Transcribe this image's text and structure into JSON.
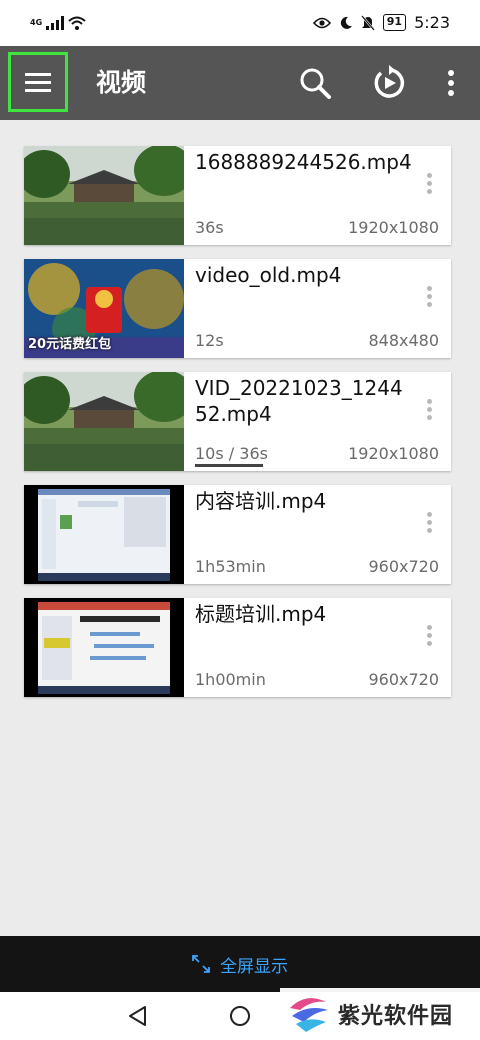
{
  "status_bar": {
    "network": "4G",
    "battery": "91",
    "time": "5:23"
  },
  "app_bar": {
    "title": "视频"
  },
  "videos": [
    {
      "name": "1688889244526.mp4",
      "duration": "36s",
      "resolution": "1920x1080",
      "thumbnail": "garden-pavilion"
    },
    {
      "name": "video_old.mp4",
      "duration": "12s",
      "resolution": "848x480",
      "thumbnail": "game-red-envelope",
      "thumb_text": "20元话费红包"
    },
    {
      "name": "VID_20221023_124452.mp4",
      "duration": "10s / 36s",
      "resolution": "1920x1080",
      "thumbnail": "garden-pavilion",
      "progress": 0.28
    },
    {
      "name": "内容培训.mp4",
      "duration": "1h53min",
      "resolution": "960x720",
      "thumbnail": "desktop-screen"
    },
    {
      "name": "标题培训.mp4",
      "duration": "1h00min",
      "resolution": "960x720",
      "thumbnail": "slide-screen"
    }
  ],
  "bottom_bar": {
    "fullscreen_label": "全屏显示"
  },
  "watermark": {
    "text": "紫光软件园"
  },
  "colors": {
    "app_bar": "#555555",
    "highlight": "#3fe43f",
    "accent": "#3ba4ff",
    "background": "#ebebeb"
  }
}
